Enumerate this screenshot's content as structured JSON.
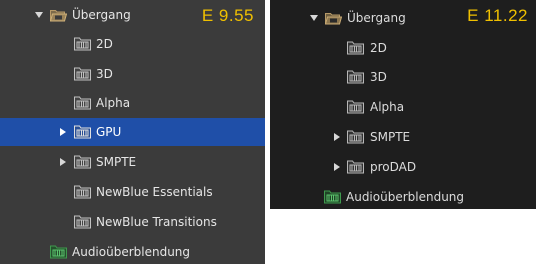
{
  "left_panel": {
    "version": "E 9.55",
    "root": {
      "label": "Übergang",
      "expanded": true
    },
    "children": [
      {
        "label": "2D",
        "expandable": false,
        "selected": false
      },
      {
        "label": "3D",
        "expandable": false,
        "selected": false
      },
      {
        "label": "Alpha",
        "expandable": false,
        "selected": false
      },
      {
        "label": "GPU",
        "expandable": true,
        "selected": true
      },
      {
        "label": "SMPTE",
        "expandable": true,
        "selected": false
      },
      {
        "label": "NewBlue Essentials",
        "expandable": false,
        "selected": false
      },
      {
        "label": "NewBlue Transitions",
        "expandable": false,
        "selected": false
      }
    ],
    "audio": {
      "label": "Audioüberblendung"
    }
  },
  "right_panel": {
    "version": "E 11.22",
    "root": {
      "label": "Übergang",
      "expanded": true
    },
    "children": [
      {
        "label": "2D",
        "expandable": false
      },
      {
        "label": "3D",
        "expandable": false
      },
      {
        "label": "Alpha",
        "expandable": false
      },
      {
        "label": "SMPTE",
        "expandable": true
      },
      {
        "label": "proDAD",
        "expandable": true
      }
    ],
    "audio": {
      "label": "Audioüberblendung"
    }
  },
  "colors": {
    "version_text": "#f0c000",
    "selection": "#1f4fa8",
    "folder_icon": "#b79a68",
    "film_icon": "#c2c2c2",
    "audio_icon": "#3f9a4e"
  }
}
